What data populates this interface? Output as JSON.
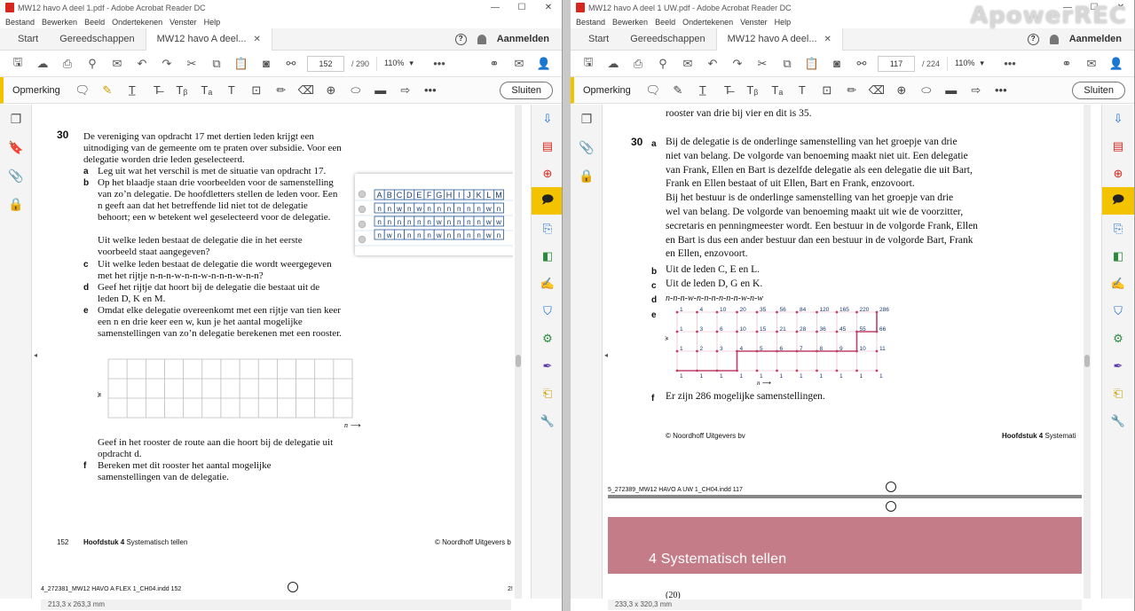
{
  "left": {
    "window_title": "MW12 havo A deel 1.pdf - Adobe Acrobat Reader DC",
    "menu": [
      "Bestand",
      "Bewerken",
      "Beeld",
      "Ondertekenen",
      "Venster",
      "Help"
    ],
    "tabs": [
      "Start",
      "Gereedschappen",
      "MW12 havo A deel..."
    ],
    "signin": "Aanmelden",
    "page_current": "152",
    "page_total": "/ 290",
    "zoom": "110%",
    "comment_label": "Opmerking",
    "close_label": "Sluiten",
    "status_size": "213,3 x 263,3 mm",
    "question": {
      "number": "30",
      "intro": "De vereniging van opdracht 17 met dertien leden krijgt een uitnodiging van de gemeente om te praten over subsidie. Voor een delegatie worden drie leden geselecteerd.",
      "parts": [
        {
          "label": "a",
          "text": "Leg uit wat het verschil is met de situatie van opdracht 17."
        },
        {
          "label": "b",
          "text": "Op het blaadje staan drie voorbeelden voor de samenstelling van zo’n delegatie. De hoofdletters stellen de leden voor. Een n geeft aan dat het betreffende lid niet tot de delegatie behoort; een w betekent wel geselecteerd voor de delegatie."
        },
        {
          "label": "",
          "text": "Uit welke leden bestaat de delegatie die in het eerste voorbeeld staat aangegeven?"
        },
        {
          "label": "c",
          "text": "Uit welke leden bestaat de delegatie die wordt weergegeven met het rijtje n-n-n-w-n-n-w-n-n-n-w-n-n?"
        },
        {
          "label": "d",
          "text": "Geef het rijtje dat hoort bij de delegatie die bestaat uit de leden D, K en M."
        },
        {
          "label": "e",
          "text": "Omdat elke delegatie overeenkomt met een rijtje van tien keer een n en drie keer een w, kun je het aantal mogelijke samenstellingen van zo’n delegatie berekenen met een rooster."
        },
        {
          "label": "",
          "text": "Geef in het rooster de route aan die hoort bij de delegatie uit opdracht d."
        },
        {
          "label": "f",
          "text": "Bereken met dit rooster het aantal mogelijke samenstellingen van de delegatie."
        }
      ],
      "letters": [
        "A",
        "B",
        "C",
        "D",
        "E",
        "F",
        "G",
        "H",
        "I",
        "J",
        "K",
        "L",
        "M"
      ],
      "rows": [
        [
          "n",
          "n",
          "w",
          "n",
          "w",
          "n",
          "n",
          "n",
          "n",
          "n",
          "n",
          "w",
          "n"
        ],
        [
          "n",
          "n",
          "n",
          "n",
          "n",
          "n",
          "w",
          "n",
          "n",
          "n",
          "n",
          "w",
          "w"
        ],
        [
          "n",
          "w",
          "n",
          "n",
          "n",
          "n",
          "w",
          "n",
          "n",
          "n",
          "n",
          "w",
          "n"
        ]
      ],
      "axis_w": "w",
      "axis_n": "n",
      "axis_arrow": "⟶"
    },
    "footer_page": "152",
    "footer_chapter_bold": "Hoofdstuk 4",
    "footer_chapter": "Systematisch tellen",
    "footer_publisher": "© Noordhoff Uitgevers b",
    "slug": "4_272381_MW12 HAVO A FLEX 1_CH04.indd 152",
    "slug_right": "2!"
  },
  "right": {
    "window_title": "MW12 havo A deel 1 UW.pdf - Adobe Acrobat Reader DC",
    "menu": [
      "Bestand",
      "Bewerken",
      "Beeld",
      "Ondertekenen",
      "Venster",
      "Help"
    ],
    "tabs": [
      "Start",
      "Gereedschappen",
      "MW12 havo A deel..."
    ],
    "signin": "Aanmelden",
    "page_current": "117",
    "page_total": "/ 224",
    "zoom": "110%",
    "comment_label": "Opmerking",
    "close_label": "Sluiten",
    "status_size": "233,3 x 320,3 mm",
    "top_line": "rooster van drie bij vier en dit is 35.",
    "answer": {
      "number": "30",
      "a_label": "a",
      "a_lines": [
        "Bij de delegatie is de onderlinge samenstelling van het groepje van drie",
        "niet van belang. De volgorde van benoeming maakt niet uit. Een delegatie",
        "van Frank, Ellen en Bart is dezelfde delegatie als een delegatie die uit Bart,",
        "Frank en Ellen bestaat of uit Ellen, Bart en Frank, enzovoort.",
        "Bij het bestuur is de onderlinge samenstelling van het groepje van drie",
        "wel van belang. De volgorde van benoeming maakt uit wie de voorzitter,",
        "secretaris en penningmeester wordt. Een bestuur in de volgorde Frank, Ellen",
        "en Bart is dus een ander bestuur dan een bestuur in de volgorde Bart, Frank",
        "en Ellen, enzovoort."
      ],
      "b_label": "b",
      "b_text": "Uit de leden C, E en L.",
      "c_label": "c",
      "c_text": "Uit de leden D, G en K.",
      "d_label": "d",
      "d_text": "n-n-n-w-n-n-n-n-n-n-w-n-w",
      "e_label": "e",
      "grid_top": [
        "1",
        "4",
        "10",
        "20",
        "35",
        "56",
        "84",
        "120",
        "165",
        "220",
        "286"
      ],
      "grid_mid": [
        "1",
        "3",
        "6",
        "10",
        "15",
        "21",
        "28",
        "36",
        "45",
        "55",
        "66"
      ],
      "grid_low": [
        "1",
        "2",
        "3",
        "4",
        "5",
        "6",
        "7",
        "8",
        "9",
        "10",
        "11"
      ],
      "grid_bottom": [
        "1",
        "1",
        "1",
        "1",
        "1",
        "1",
        "1",
        "1",
        "1",
        "1",
        "1"
      ],
      "axis_w": "w",
      "axis_n": "n ⟶",
      "f_label": "f",
      "f_text": "Er zijn 286 mogelijke samenstellingen."
    },
    "footer_publisher": "© Noordhoff Uitgevers bv",
    "footer_chapter_bold": "Hoofdstuk 4",
    "footer_chapter": "Systemati",
    "slug": "5_272389_MW12 HAVO A UW 1_CH04.indd 117",
    "chapter_banner": "4  Systematisch tellen",
    "next_top": "(20)"
  },
  "watermark": "ApowerREC",
  "colors": {
    "accent": "#f3c300",
    "grid_line": "#c0406a",
    "banner": "#c47d88",
    "cell_blue": "#2a5a9a"
  }
}
